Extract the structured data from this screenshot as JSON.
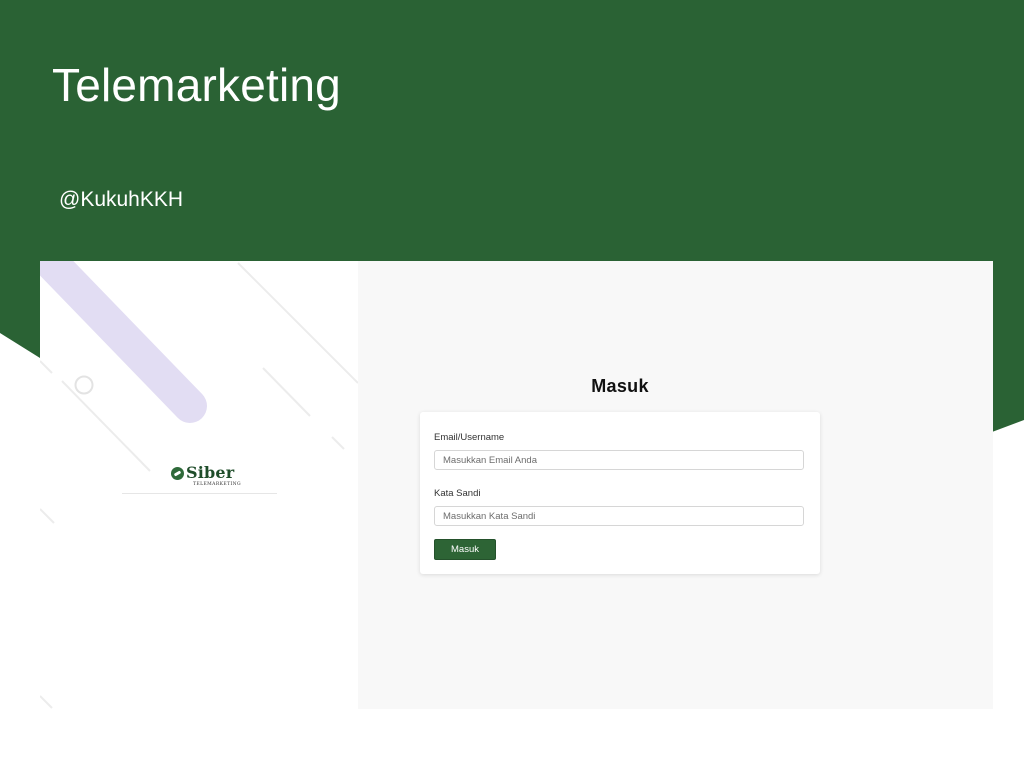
{
  "slide": {
    "title": "Telemarketing",
    "handle": "@KukuhKKH",
    "background_color": "#2a6234"
  },
  "logo": {
    "brand": "Siber",
    "tagline": "TELEMARKETING",
    "icon": "siber-logo-icon"
  },
  "login": {
    "title": "Masuk",
    "email_label": "Email/Username",
    "email_placeholder": "Masukkan Email Anda",
    "email_value": "",
    "password_label": "Kata Sandi",
    "password_placeholder": "Masukkan Kata Sandi",
    "password_value": "",
    "submit_label": "Masuk",
    "button_color": "#2d6435"
  }
}
